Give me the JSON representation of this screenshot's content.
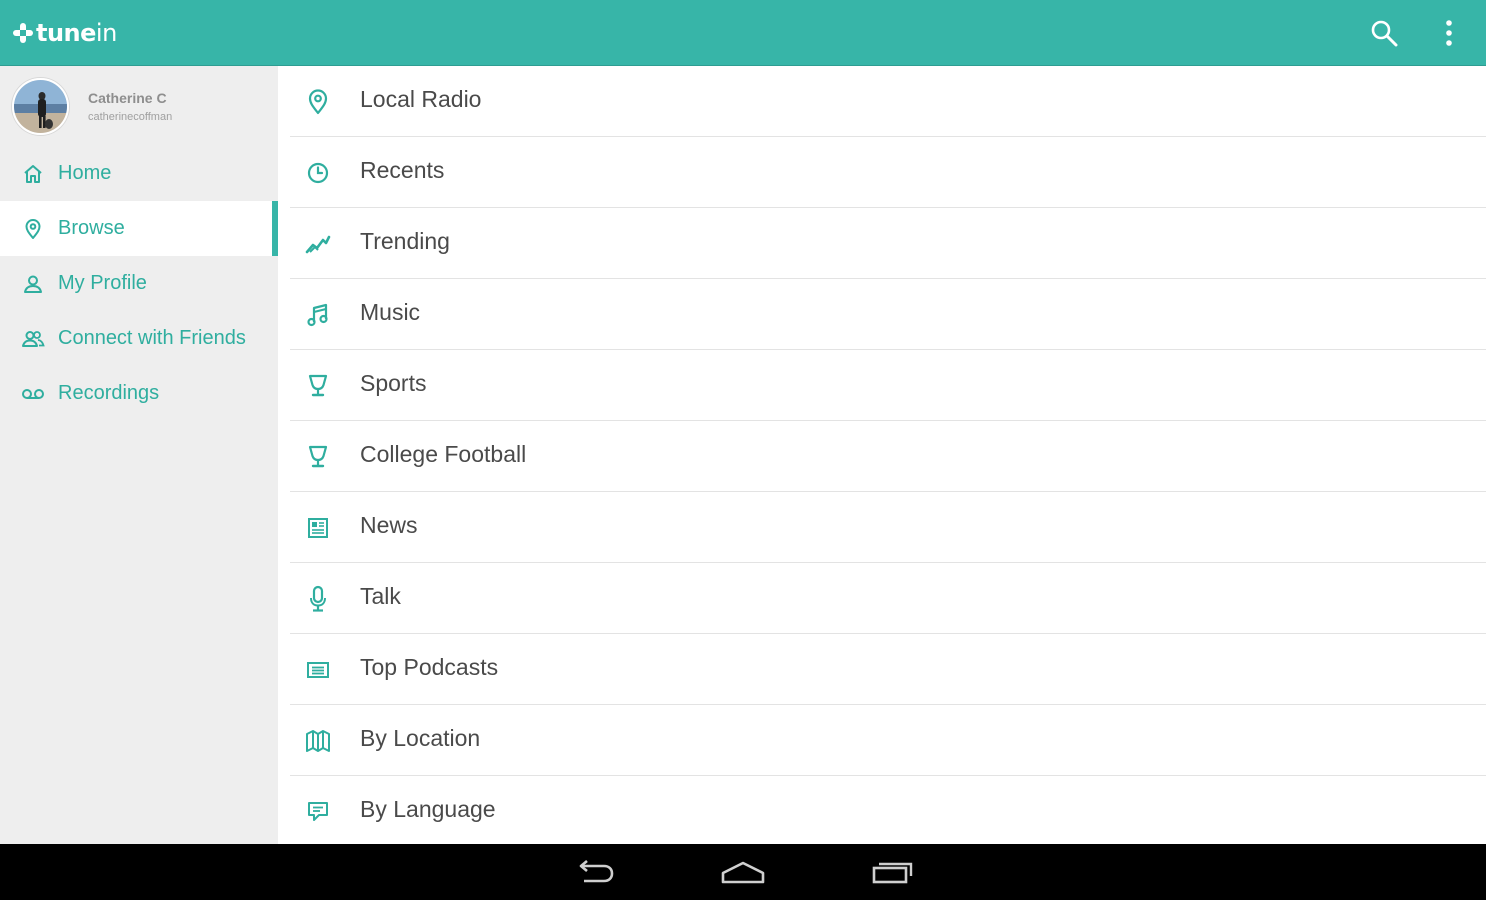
{
  "app": {
    "logo_text_bold": "tune",
    "logo_text_light": "in",
    "accent_color": "#37b5a8",
    "icons": {
      "search": "search-icon",
      "more": "more-vert-icon"
    }
  },
  "profile": {
    "name": "Catherine C",
    "username": "catherinecoffman"
  },
  "sidebar": {
    "items": [
      {
        "label": "Home",
        "icon": "home-icon",
        "active": false
      },
      {
        "label": "Browse",
        "icon": "location-pin-icon",
        "active": true
      },
      {
        "label": "My Profile",
        "icon": "person-icon",
        "active": false
      },
      {
        "label": "Connect with Friends",
        "icon": "people-icon",
        "active": false
      },
      {
        "label": "Recordings",
        "icon": "voicemail-icon",
        "active": false
      }
    ]
  },
  "browse": {
    "items": [
      {
        "label": "Local Radio",
        "icon": "location-pin-icon"
      },
      {
        "label": "Recents",
        "icon": "clock-icon"
      },
      {
        "label": "Trending",
        "icon": "trending-icon"
      },
      {
        "label": "Music",
        "icon": "music-note-icon"
      },
      {
        "label": "Sports",
        "icon": "trophy-icon"
      },
      {
        "label": "College Football",
        "icon": "trophy-icon"
      },
      {
        "label": "News",
        "icon": "newspaper-icon"
      },
      {
        "label": "Talk",
        "icon": "microphone-icon"
      },
      {
        "label": "Top Podcasts",
        "icon": "podcast-list-icon"
      },
      {
        "label": "By Location",
        "icon": "map-icon"
      },
      {
        "label": "By Language",
        "icon": "speech-bubble-icon"
      }
    ]
  },
  "system_nav": {
    "icons": {
      "back": "back-icon",
      "home": "home-system-icon",
      "recents": "recent-apps-icon"
    }
  }
}
